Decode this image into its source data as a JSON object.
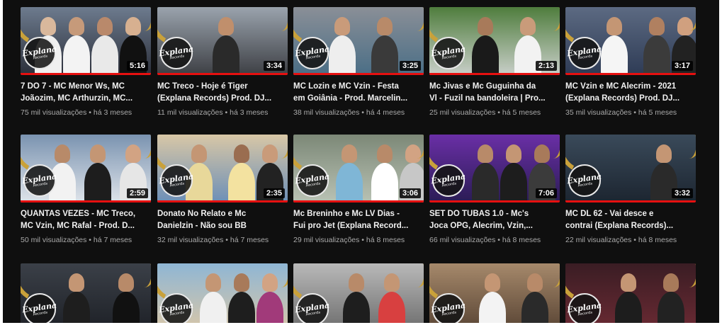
{
  "channel_logo": {
    "line1": "Explana",
    "line2": "Records"
  },
  "colors": {
    "progress": "#e61010",
    "accent_gold": "#c9a13a",
    "page_bg": "#0f0f0f"
  },
  "videos": [
    {
      "title": "7 DO 7 - MC Menor Ws, MC\nJoãozim, MC Arthurzin, MC...",
      "duration": "5:16",
      "views": "75 mil visualizações",
      "age": "há 3 meses",
      "watched": 1.0
    },
    {
      "title": "MC Treco - Hoje é Tiger\n(Explana Records) Prod. DJ...",
      "duration": "3:34",
      "views": "11 mil visualizações",
      "age": "há 3 meses",
      "watched": 1.0
    },
    {
      "title": "MC Lozin e MC Vzin - Festa\nem Goiânia - Prod. Marcelin...",
      "duration": "3:25",
      "views": "38 mil visualizações",
      "age": "há 4 meses",
      "watched": 1.0
    },
    {
      "title": "Mc Jivas e Mc Guguinha da\nVl - Fuzil na bandoleira | Pro...",
      "duration": "2:13",
      "views": "25 mil visualizações",
      "age": "há 5 meses",
      "watched": 1.0
    },
    {
      "title": "MC Vzin e MC Alecrim - 2021\n(Explana Records) Prod. DJ...",
      "duration": "3:17",
      "views": "35 mil visualizações",
      "age": "há 5 meses",
      "watched": 1.0
    },
    {
      "title": "QUANTAS VEZES - MC Treco,\nMC Vzin, MC Rafal - Prod. D...",
      "duration": "2:59",
      "views": "50 mil visualizações",
      "age": "há 7 meses",
      "watched": 1.0
    },
    {
      "title": "Donato No Relato e Mc\nDanielzin - Não sou BB",
      "duration": "2:35",
      "views": "32 mil visualizações",
      "age": "há 7 meses",
      "watched": 1.0
    },
    {
      "title": "Mc Breninho e Mc LV Dias -\nFui pro Jet (Explana Record...",
      "duration": "3:06",
      "views": "29 mil visualizações",
      "age": "há 8 meses",
      "watched": 1.0
    },
    {
      "title": "SET DO TUBAS 1.0 - Mc's\nJoca OPG, Alecrim, Vzin,...",
      "duration": "7:06",
      "views": "66 mil visualizações",
      "age": "há 8 meses",
      "watched": 1.0
    },
    {
      "title": "MC DL 62 - Vai desce e\ncontrai (Explana Records)...",
      "duration": "3:32",
      "views": "22 mil visualizações",
      "age": "há 8 meses",
      "watched": 1.0
    },
    {
      "title": "",
      "duration": "",
      "views": "",
      "age": "",
      "watched": 0
    },
    {
      "title": "",
      "duration": "",
      "views": "",
      "age": "",
      "watched": 0
    },
    {
      "title": "",
      "duration": "",
      "views": "",
      "age": "",
      "watched": 0
    },
    {
      "title": "",
      "duration": "",
      "views": "",
      "age": "",
      "watched": 0
    },
    {
      "title": "",
      "duration": "",
      "views": "",
      "age": "",
      "watched": 0
    }
  ]
}
